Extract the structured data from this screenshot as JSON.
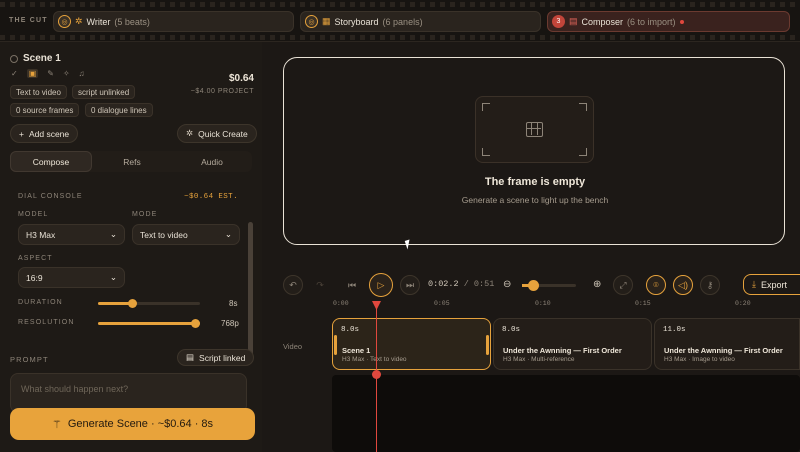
{
  "topbar": {
    "label": "THE CUT",
    "tabs": [
      {
        "num": "◎",
        "icon": "✲",
        "name": "Writer",
        "detail": "(5 beats)"
      },
      {
        "num": "◎",
        "icon": "▦",
        "name": "Storyboard",
        "detail": "(6 panels)"
      },
      {
        "num": "3",
        "icon": "▤",
        "name": "Composer",
        "detail": "(6 to import)"
      }
    ]
  },
  "scene": {
    "title": "Scene 1",
    "price": "$0.64",
    "price_sub": "~$4.00 PROJECT",
    "chips": [
      "Text to video",
      "script unlinked",
      "0 source frames",
      "0 dialogue lines"
    ],
    "add_scene": "Add scene",
    "quick_create": "Quick Create"
  },
  "tabs": [
    "Compose",
    "Refs",
    "Audio"
  ],
  "dial": {
    "label": "DIAL CONSOLE",
    "est": "~$0.64 EST.",
    "model_label": "MODEL",
    "model_value": "H3 Max",
    "mode_label": "MODE",
    "mode_value": "Text to video",
    "aspect_label": "ASPECT",
    "aspect_value": "16:9",
    "duration_label": "DURATION",
    "duration_value": "8s",
    "duration_fraction": 0.33,
    "resolution_label": "RESOLUTION",
    "resolution_value": "768p",
    "resolution_fraction": 1.0
  },
  "prompt": {
    "label": "PROMPT",
    "script_linked": "Script linked",
    "placeholder": "What should happen next?"
  },
  "generate_label": "Generate Scene · ~$0.64 · 8s",
  "bench": {
    "title": "The frame is empty",
    "subtitle": "Generate a scene to light up the bench"
  },
  "transport": {
    "time_current": "0:02.2",
    "time_total": "0:51",
    "export_label": "Export",
    "zoom_fraction": 0.15
  },
  "ruler": [
    "0:00",
    "0:05",
    "0:10",
    "0:15",
    "0:20"
  ],
  "timeline": {
    "track_label": "Video",
    "clips": [
      {
        "dur": "8.0s",
        "title": "Scene 1",
        "sub": "H3 Max · Text to video"
      },
      {
        "dur": "8.0s",
        "title": "Under the Awnning — First Order",
        "sub": "H3 Max · Multi-reference"
      },
      {
        "dur": "11.0s",
        "title": "Under the Awnning — First Order",
        "sub": "H3 Max · Image to video"
      }
    ]
  }
}
